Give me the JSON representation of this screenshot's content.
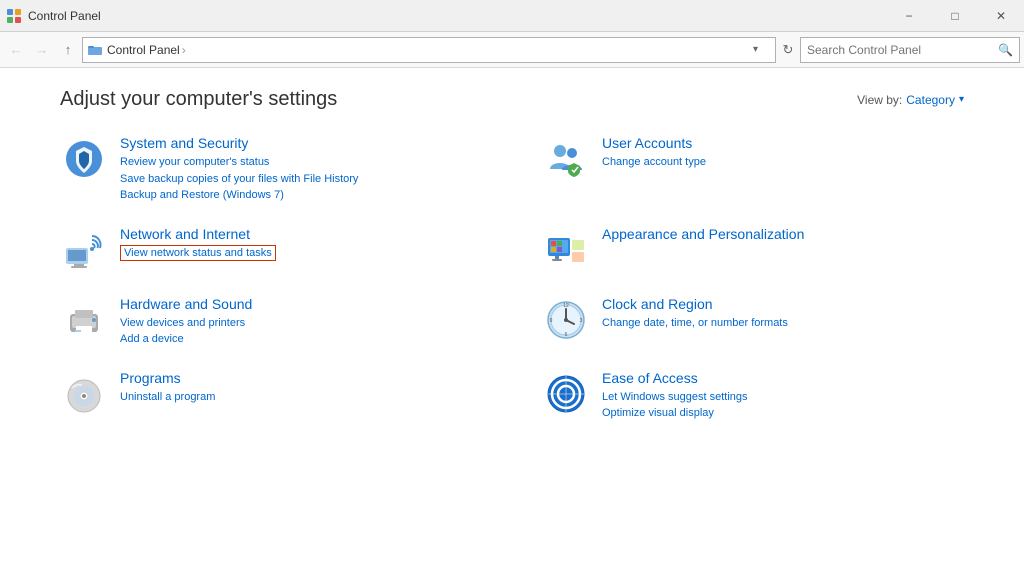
{
  "titlebar": {
    "title": "Control Panel",
    "minimize_label": "−",
    "maximize_label": "□",
    "close_label": "✕"
  },
  "addressbar": {
    "back_label": "←",
    "forward_label": "→",
    "up_label": "↑",
    "path_segments": [
      "Control Panel"
    ],
    "search_placeholder": "Search Control Panel",
    "refresh_label": "↻",
    "dropdown_label": "▾"
  },
  "page": {
    "title": "Adjust your computer's settings",
    "viewby_label": "View by:",
    "viewby_value": "Category",
    "viewby_arrow": "▾"
  },
  "categories": [
    {
      "id": "system-security",
      "title": "System and Security",
      "links": [
        "Review your computer's status",
        "Save backup copies of your files with File History",
        "Backup and Restore (Windows 7)"
      ]
    },
    {
      "id": "user-accounts",
      "title": "User Accounts",
      "links": [
        "Change account type"
      ]
    },
    {
      "id": "network-internet",
      "title": "Network and Internet",
      "links": [
        "View network status and tasks"
      ],
      "highlighted_link_index": 0
    },
    {
      "id": "appearance-personalization",
      "title": "Appearance and Personalization",
      "links": []
    },
    {
      "id": "hardware-sound",
      "title": "Hardware and Sound",
      "links": [
        "View devices and printers",
        "Add a device"
      ]
    },
    {
      "id": "clock-region",
      "title": "Clock and Region",
      "links": [
        "Change date, time, or number formats"
      ]
    },
    {
      "id": "programs",
      "title": "Programs",
      "links": [
        "Uninstall a program"
      ]
    },
    {
      "id": "ease-of-access",
      "title": "Ease of Access",
      "links": [
        "Let Windows suggest settings",
        "Optimize visual display"
      ]
    }
  ]
}
